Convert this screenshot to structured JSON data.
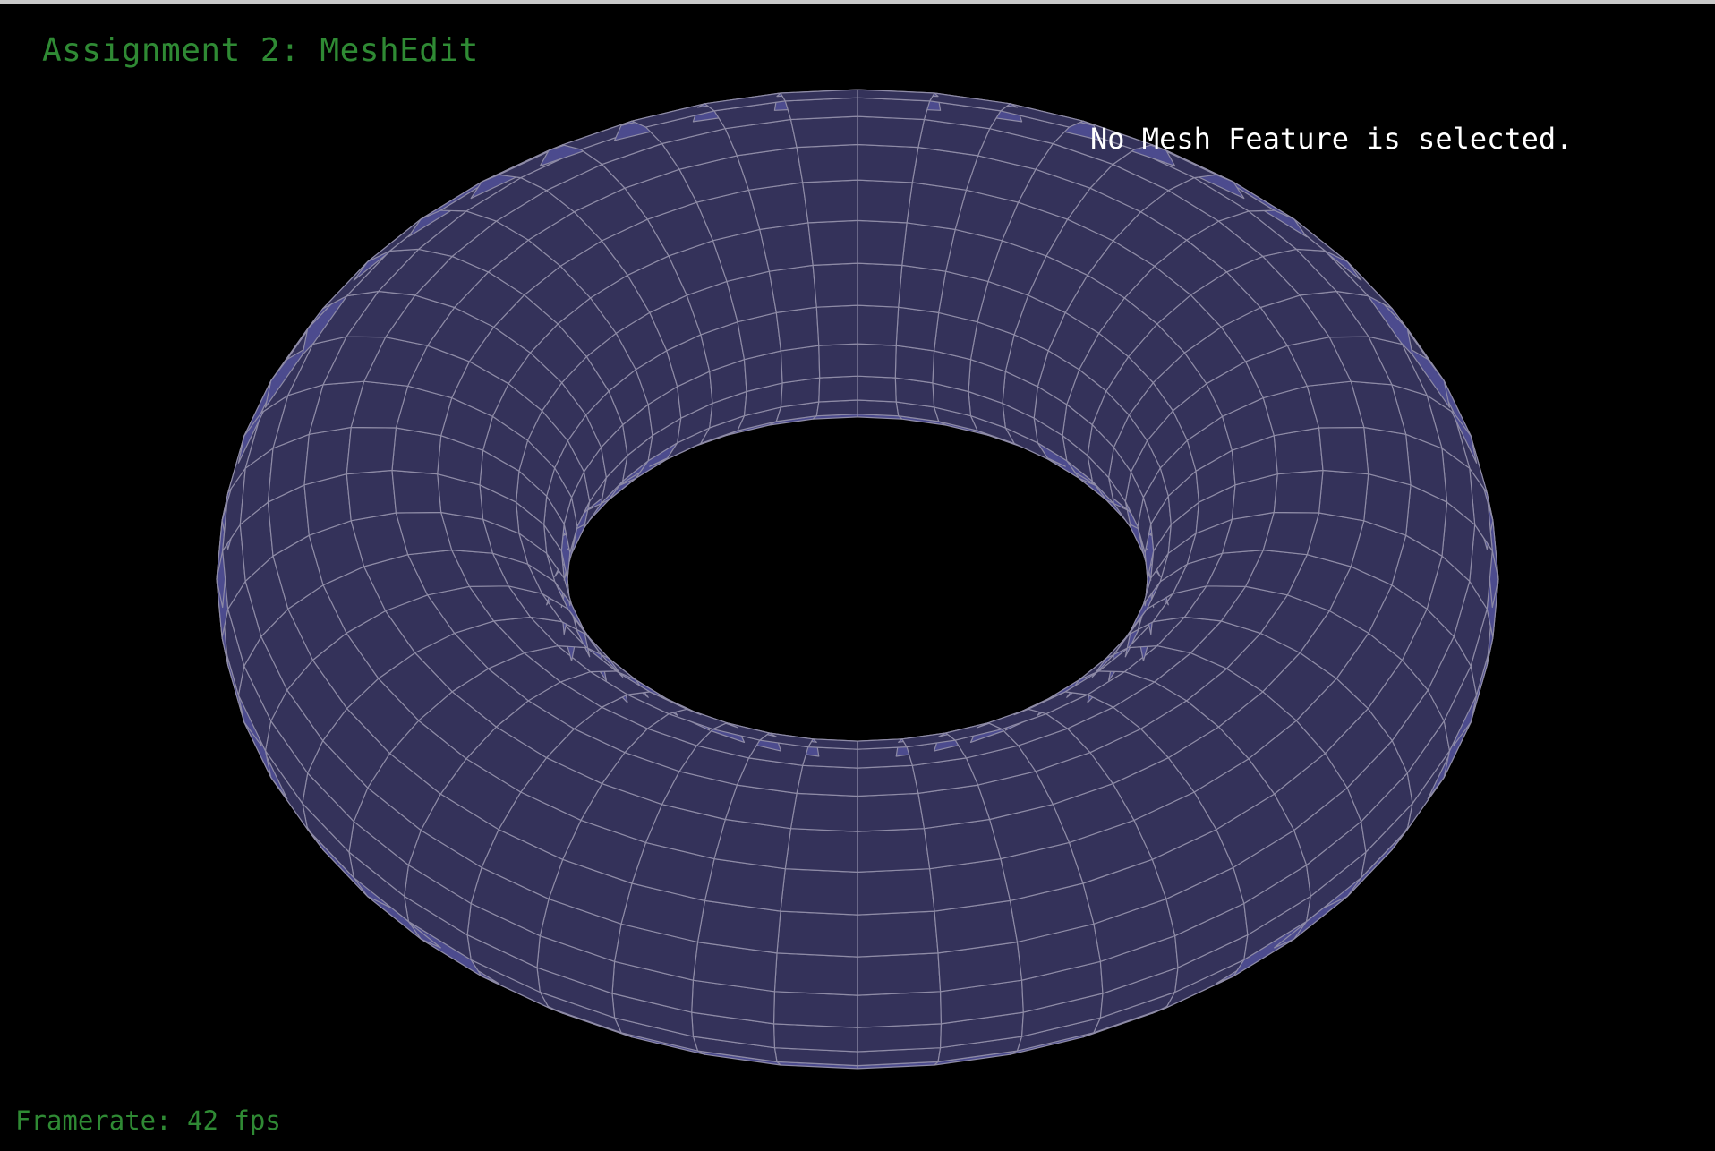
{
  "app": {
    "title": "Assignment 2: MeshEdit"
  },
  "status": {
    "selection": "No Mesh Feature is selected.",
    "framerate": "Framerate: 42 fps"
  },
  "colors": {
    "background": "#000000",
    "title_text": "#2f8a34",
    "status_text": "#ffffff",
    "framerate_text": "#2f8a34",
    "mesh_face": "#34325a",
    "mesh_face_lit": "#4c4b8e",
    "mesh_edge": "#8e8ba6",
    "window_border": "#c9c9c9"
  },
  "mesh": {
    "type": "torus",
    "major_segments": 48,
    "minor_segments": 24,
    "display": "wireframe-over-shaded"
  }
}
